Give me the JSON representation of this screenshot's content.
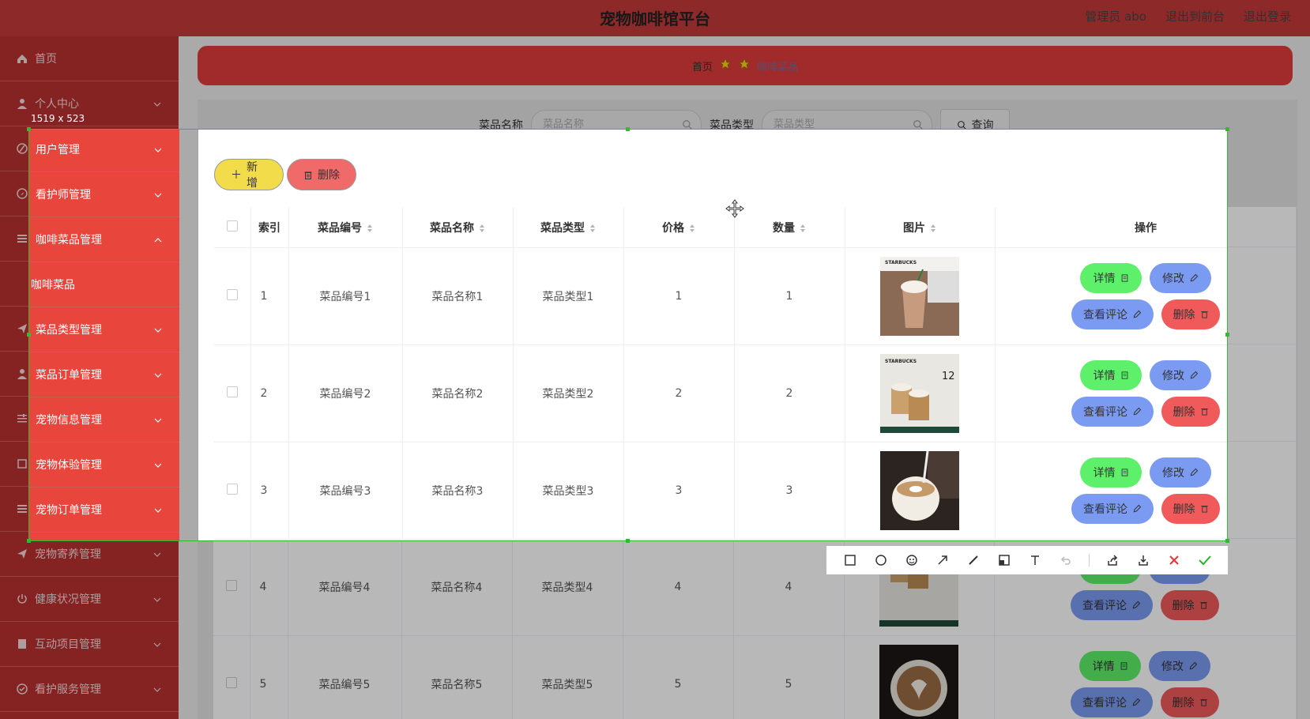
{
  "header": {
    "title": "宠物咖啡馆平台",
    "user": "管理员 abo",
    "front_link": "退出到前台",
    "logout": "退出登录"
  },
  "sidebar": {
    "items": [
      {
        "label": "首页",
        "icon": "home-icon"
      },
      {
        "label": "个人中心",
        "icon": "user-icon"
      },
      {
        "label": "用户管理",
        "icon": "users-icon"
      },
      {
        "label": "看护师管理",
        "icon": "compass-icon"
      },
      {
        "label": "咖啡菜品管理",
        "icon": "list-icon"
      },
      {
        "label": "咖啡菜品",
        "icon": ""
      },
      {
        "label": "菜品类型管理",
        "icon": "send-icon"
      },
      {
        "label": "菜品订单管理",
        "icon": "user-icon"
      },
      {
        "label": "宠物信息管理",
        "icon": "sliders-icon"
      },
      {
        "label": "宠物体验管理",
        "icon": "square-icon"
      },
      {
        "label": "宠物订单管理",
        "icon": "list-icon"
      },
      {
        "label": "宠物寄养管理",
        "icon": "send-icon"
      },
      {
        "label": "健康状况管理",
        "icon": "power-icon"
      },
      {
        "label": "互动项目管理",
        "icon": "book-icon"
      },
      {
        "label": "看护服务管理",
        "icon": "check-circle-icon"
      }
    ]
  },
  "breadcrumb": {
    "home": "首页",
    "current": "咖啡菜品"
  },
  "search": {
    "name_label": "菜品名称",
    "name_placeholder": "菜品名称",
    "type_label": "菜品类型",
    "type_placeholder": "菜品类型",
    "query_label": "查询"
  },
  "actions": {
    "add_label": "新增",
    "delete_label": "删除"
  },
  "screenshot_overlay": {
    "size_label": "1519 x 523"
  },
  "table": {
    "columns": [
      "索引",
      "菜品编号",
      "菜品名称",
      "菜品类型",
      "价格",
      "数量",
      "图片",
      "操作"
    ],
    "rows": [
      {
        "index": "1",
        "code": "菜品编号1",
        "name": "菜品名称1",
        "type": "菜品类型1",
        "price": "1",
        "qty": "1"
      },
      {
        "index": "2",
        "code": "菜品编号2",
        "name": "菜品名称2",
        "type": "菜品类型2",
        "price": "2",
        "qty": "2"
      },
      {
        "index": "3",
        "code": "菜品编号3",
        "name": "菜品名称3",
        "type": "菜品类型3",
        "price": "3",
        "qty": "3"
      },
      {
        "index": "4",
        "code": "菜品编号4",
        "name": "菜品名称4",
        "type": "菜品类型4",
        "price": "4",
        "qty": "4"
      },
      {
        "index": "5",
        "code": "菜品编号5",
        "name": "菜品名称5",
        "type": "菜品类型5",
        "price": "5",
        "qty": "5"
      }
    ],
    "row_buttons": {
      "detail": "详情",
      "edit": "修改",
      "comments": "查看评论",
      "delete": "删除"
    }
  },
  "image_text": {
    "brand": "STARBUCKS",
    "promo": "12"
  },
  "colors": {
    "header_bg": "#c43a3a",
    "sidebar_bg": "#b93030",
    "sidebar_highlight": "#e8453c",
    "detail_button": "#5ef06a",
    "edit_button": "#7b9bf2",
    "delete_button": "#f05a5a",
    "add_button": "#f2dc4a",
    "capture_border": "#35b935"
  }
}
